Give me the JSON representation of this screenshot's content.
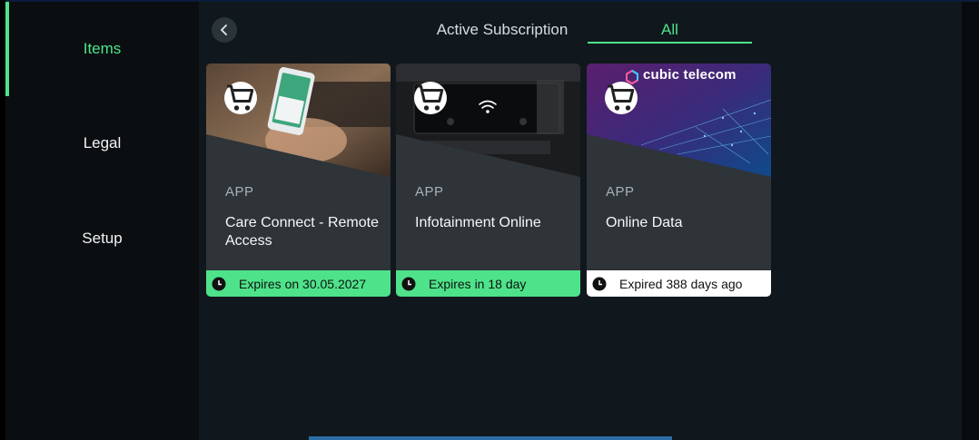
{
  "sidebar": {
    "items": [
      {
        "label": "Items",
        "active": true
      },
      {
        "label": "Legal",
        "active": false
      },
      {
        "label": "Setup",
        "active": false
      }
    ]
  },
  "header": {
    "tabs": [
      {
        "label": "Active Subscription",
        "active": false
      },
      {
        "label": "All",
        "active": true
      }
    ]
  },
  "cards": [
    {
      "type": "APP",
      "title": "Care Connect - Remote Access",
      "status": "Expires on 30.05.2027",
      "status_color": "#4ee38a"
    },
    {
      "type": "APP",
      "title": "Infotainment Online",
      "status": "Expires in 18 day",
      "status_color": "#4ee38a"
    },
    {
      "type": "APP",
      "title": "Online Data",
      "status": "Expired 388 days ago",
      "status_color": "#ffffff",
      "brand": "cubic telecom"
    }
  ],
  "colors": {
    "accent": "#4ee38a",
    "card_bg": "#2e3438",
    "main_bg": "#11181d"
  }
}
